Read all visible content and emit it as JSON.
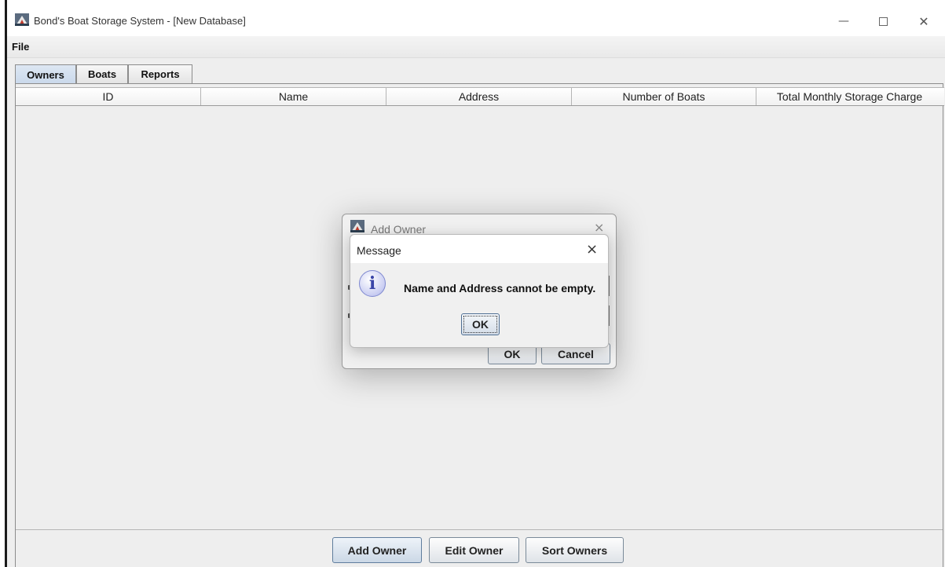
{
  "window": {
    "title": "Bond's Boat Storage System - [New Database]",
    "controls": {
      "minimize": "—",
      "close": "✕"
    }
  },
  "menubar": {
    "file": "File"
  },
  "tabs": [
    {
      "label": "Owners",
      "active": true
    },
    {
      "label": "Boats",
      "active": false
    },
    {
      "label": "Reports",
      "active": false
    }
  ],
  "table": {
    "columns": [
      "ID",
      "Name",
      "Address",
      "Number of Boats",
      "Total Monthly Storage Charge"
    ],
    "rows": []
  },
  "buttons": {
    "add_owner": "Add Owner",
    "edit_owner": "Edit Owner",
    "sort_owners": "Sort Owners"
  },
  "add_owner_dialog": {
    "title": "Add Owner",
    "close": "×",
    "ok": "OK",
    "cancel": "Cancel"
  },
  "message_dialog": {
    "title": "Message",
    "close": "×",
    "icon": "info-icon",
    "icon_glyph": "i",
    "text": "Name and Address cannot be empty.",
    "ok": "OK"
  },
  "colors": {
    "panel_bg": "#eeeeee",
    "active_tab": "#c9d8ea",
    "info_icon": "#3944a8"
  }
}
